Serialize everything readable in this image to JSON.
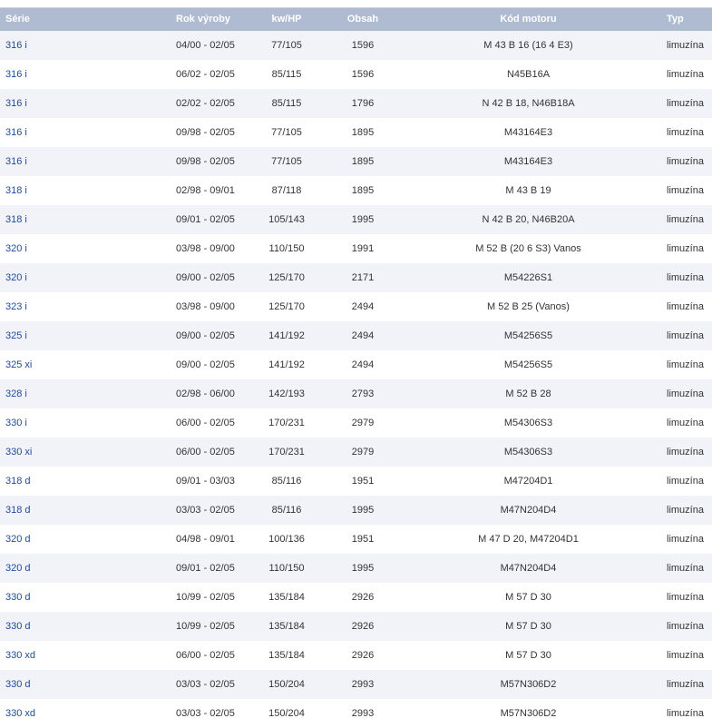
{
  "table": {
    "headers": {
      "serie": "Série",
      "rok": "Rok výroby",
      "kw": "kw/HP",
      "obsah": "Obsah",
      "kod": "Kód motoru",
      "typ": "Typ"
    },
    "rows": [
      {
        "serie": "316 i",
        "rok": "04/00 - 02/05",
        "kw": "77/105",
        "obsah": "1596",
        "kod": "M 43 B 16 (16 4 E3)",
        "typ": "limuzína"
      },
      {
        "serie": "316 i",
        "rok": "06/02 - 02/05",
        "kw": "85/115",
        "obsah": "1596",
        "kod": "N45B16A",
        "typ": "limuzína"
      },
      {
        "serie": "316 i",
        "rok": "02/02 - 02/05",
        "kw": "85/115",
        "obsah": "1796",
        "kod": "N 42 B 18, N46B18A",
        "typ": "limuzína"
      },
      {
        "serie": "316 i",
        "rok": "09/98 - 02/05",
        "kw": "77/105",
        "obsah": "1895",
        "kod": "M43164E3",
        "typ": "limuzína"
      },
      {
        "serie": "316 i",
        "rok": "09/98 - 02/05",
        "kw": "77/105",
        "obsah": "1895",
        "kod": "M43164E3",
        "typ": "limuzína"
      },
      {
        "serie": "318 i",
        "rok": "02/98 - 09/01",
        "kw": "87/118",
        "obsah": "1895",
        "kod": "M 43 B 19",
        "typ": "limuzína"
      },
      {
        "serie": "318 i",
        "rok": "09/01 - 02/05",
        "kw": "105/143",
        "obsah": "1995",
        "kod": "N 42 B 20, N46B20A",
        "typ": "limuzína"
      },
      {
        "serie": "320 i",
        "rok": "03/98 - 09/00",
        "kw": "110/150",
        "obsah": "1991",
        "kod": "M 52 B (20 6 S3) Vanos",
        "typ": "limuzína"
      },
      {
        "serie": "320 i",
        "rok": "09/00 - 02/05",
        "kw": "125/170",
        "obsah": "2171",
        "kod": "M54226S1",
        "typ": "limuzína"
      },
      {
        "serie": "323 i",
        "rok": "03/98 - 09/00",
        "kw": "125/170",
        "obsah": "2494",
        "kod": "M 52 B 25 (Vanos)",
        "typ": "limuzína"
      },
      {
        "serie": "325 i",
        "rok": "09/00 - 02/05",
        "kw": "141/192",
        "obsah": "2494",
        "kod": "M54256S5",
        "typ": "limuzína"
      },
      {
        "serie": "325 xi",
        "rok": "09/00 - 02/05",
        "kw": "141/192",
        "obsah": "2494",
        "kod": "M54256S5",
        "typ": "limuzína"
      },
      {
        "serie": "328 i",
        "rok": "02/98 - 06/00",
        "kw": "142/193",
        "obsah": "2793",
        "kod": "M 52 B 28",
        "typ": "limuzína"
      },
      {
        "serie": "330 i",
        "rok": "06/00 - 02/05",
        "kw": "170/231",
        "obsah": "2979",
        "kod": "M54306S3",
        "typ": "limuzína"
      },
      {
        "serie": "330 xi",
        "rok": "06/00 - 02/05",
        "kw": "170/231",
        "obsah": "2979",
        "kod": "M54306S3",
        "typ": "limuzína"
      },
      {
        "serie": "318 d",
        "rok": "09/01 - 03/03",
        "kw": "85/116",
        "obsah": "1951",
        "kod": "M47204D1",
        "typ": "limuzína"
      },
      {
        "serie": "318 d",
        "rok": "03/03 - 02/05",
        "kw": "85/116",
        "obsah": "1995",
        "kod": "M47N204D4",
        "typ": "limuzína"
      },
      {
        "serie": "320 d",
        "rok": "04/98 - 09/01",
        "kw": "100/136",
        "obsah": "1951",
        "kod": "M 47 D 20, M47204D1",
        "typ": "limuzína"
      },
      {
        "serie": "320 d",
        "rok": "09/01 - 02/05",
        "kw": "110/150",
        "obsah": "1995",
        "kod": "M47N204D4",
        "typ": "limuzína"
      },
      {
        "serie": "330 d",
        "rok": "10/99 - 02/05",
        "kw": "135/184",
        "obsah": "2926",
        "kod": "M 57 D 30",
        "typ": "limuzína"
      },
      {
        "serie": "330 d",
        "rok": "10/99 - 02/05",
        "kw": "135/184",
        "obsah": "2926",
        "kod": "M 57 D 30",
        "typ": "limuzína"
      },
      {
        "serie": "330 xd",
        "rok": "06/00 - 02/05",
        "kw": "135/184",
        "obsah": "2926",
        "kod": "M 57 D 30",
        "typ": "limuzína"
      },
      {
        "serie": "330 d",
        "rok": "03/03 - 02/05",
        "kw": "150/204",
        "obsah": "2993",
        "kod": "M57N306D2",
        "typ": "limuzína"
      },
      {
        "serie": "330 xd",
        "rok": "03/03 - 02/05",
        "kw": "150/204",
        "obsah": "2993",
        "kod": "M57N306D2",
        "typ": "limuzína"
      }
    ]
  }
}
